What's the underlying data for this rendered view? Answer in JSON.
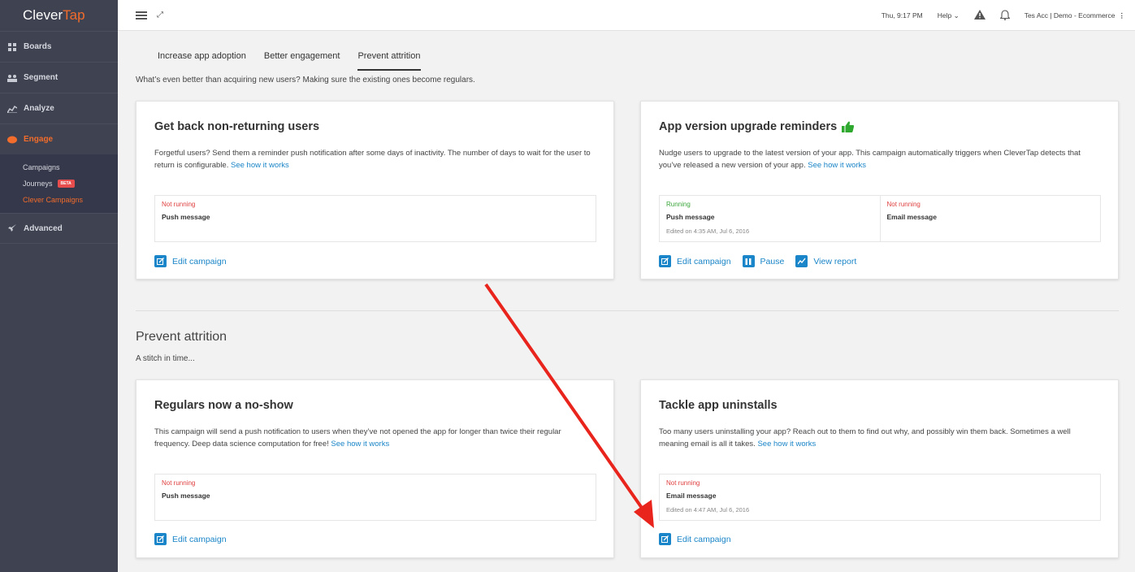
{
  "brand": {
    "left": "Clever",
    "right": "Tap",
    "accent": "#f26c2b"
  },
  "sidebar": {
    "items": [
      {
        "label": "Boards",
        "icon": "boards-icon"
      },
      {
        "label": "Segment",
        "icon": "segment-icon"
      },
      {
        "label": "Analyze",
        "icon": "analyze-icon"
      },
      {
        "label": "Engage",
        "icon": "engage-icon"
      },
      {
        "label": "Advanced",
        "icon": "rocket-icon"
      }
    ],
    "engage_sub": [
      {
        "label": "Campaigns"
      },
      {
        "label": "Journeys",
        "badge": "BETA"
      },
      {
        "label": "Clever Campaigns"
      }
    ]
  },
  "topbar": {
    "time": "Thu, 9:17 PM",
    "help": "Help",
    "account": "Tes Acc | Demo - Ecommerce"
  },
  "tabs": [
    "Increase app adoption",
    "Better engagement",
    "Prevent attrition"
  ],
  "intro": "What’s even better than acquiring new users? Making sure the existing ones become regulars.",
  "link_text": "See how it works",
  "cards": [
    {
      "title": "Get back non-returning users",
      "desc": "Forgetful users? Send them a reminder push notification after some days of inactivity. The number of days to wait for the user to return is configurable.",
      "status": [
        {
          "state": "Not running",
          "message": "Push message"
        }
      ],
      "actions": [
        "Edit campaign"
      ]
    },
    {
      "title": "App version upgrade reminders",
      "desc": "Nudge users to upgrade to the latest version of your app. This campaign automatically triggers when CleverTap detects that you’ve released a new version of your app.",
      "status": [
        {
          "state": "Running",
          "message": "Push message",
          "edited": "Edited on 4:35 AM, Jul 6, 2016"
        },
        {
          "state": "Not running",
          "message": "Email message"
        }
      ],
      "actions": [
        "Edit campaign",
        "Pause",
        "View report"
      ]
    },
    {
      "title": "Regulars now a no-show",
      "desc": "This campaign will send a push notification to users when they’ve not opened the app for longer than twice their regular frequency. Deep data science computation for free!",
      "status": [
        {
          "state": "Not running",
          "message": "Push message"
        }
      ],
      "actions": [
        "Edit campaign"
      ]
    },
    {
      "title": "Tackle app uninstalls",
      "desc": "Too many users uninstalling your app? Reach out to them to find out why, and possibly win them back. Sometimes a well meaning email is all it takes.",
      "status": [
        {
          "state": "Not running",
          "message": "Email message",
          "edited": "Edited on 4:47 AM, Jul 6, 2016"
        }
      ],
      "actions": [
        "Edit campaign"
      ]
    }
  ],
  "section": {
    "title": "Prevent attrition",
    "subtitle": "A stitch in time..."
  },
  "colors": {
    "link": "#1a85c8",
    "running": "#3aa63a",
    "not_running": "#e04040",
    "arrow": "#e8241c"
  }
}
